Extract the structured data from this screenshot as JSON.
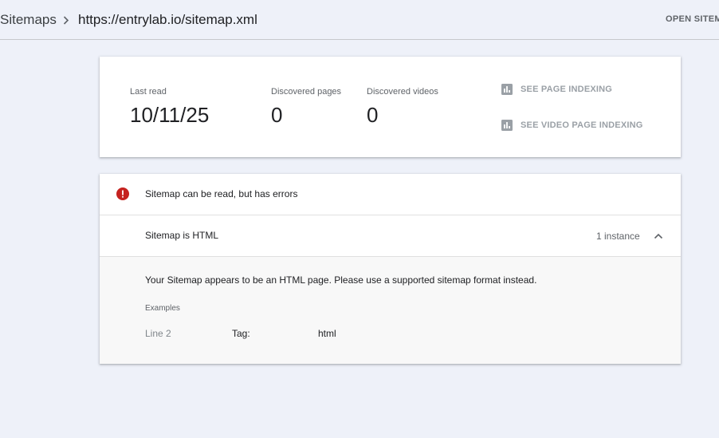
{
  "breadcrumb": {
    "root": "Sitemaps",
    "current": "https://entrylab.io/sitemap.xml",
    "open_button": "OPEN SITEMAP"
  },
  "summary": {
    "last_read_label": "Last read",
    "last_read_value": "10/11/25",
    "pages_label": "Discovered pages",
    "pages_value": "0",
    "videos_label": "Discovered videos",
    "videos_value": "0",
    "see_page_indexing": "SEE PAGE INDEXING",
    "see_video_indexing": "SEE VIDEO PAGE INDEXING"
  },
  "errors": {
    "status_text": "Sitemap can be read, but has errors",
    "status_color": "#c5221f",
    "issue": {
      "name": "Sitemap is HTML",
      "count": "1 instance",
      "description": "Your Sitemap appears to be an HTML page. Please use a supported sitemap format instead.",
      "examples_label": "Examples",
      "examples": [
        {
          "line": "Line 2",
          "tag_label": "Tag:",
          "value": "html"
        }
      ]
    }
  },
  "icons": {
    "breadcrumb_separator": "chevron-right-icon",
    "indexing_link": "bar-chart-icon",
    "status": "error-icon",
    "collapse": "chevron-up-icon"
  }
}
